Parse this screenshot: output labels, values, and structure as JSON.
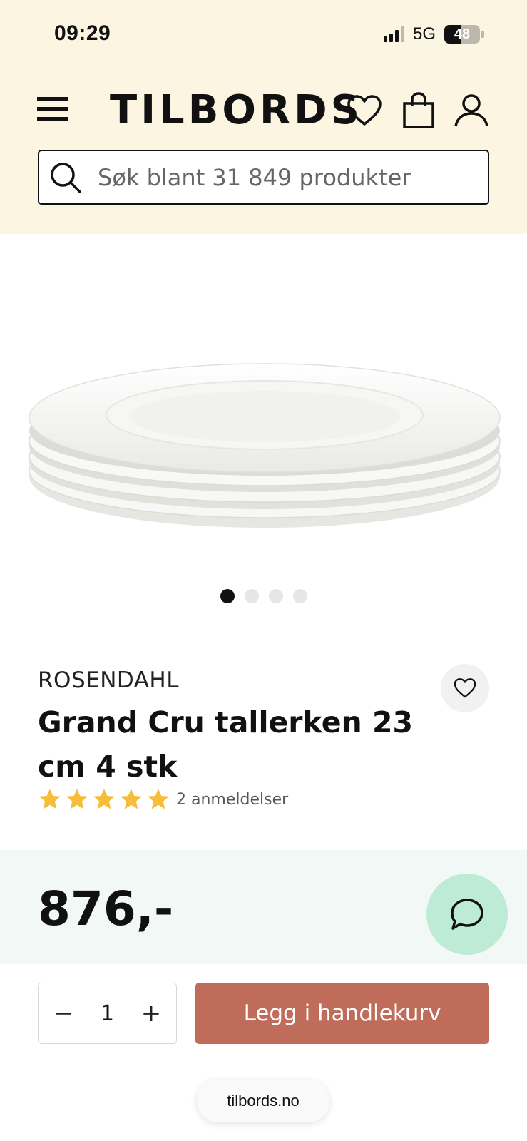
{
  "status_bar": {
    "time": "09:29",
    "network": "5G",
    "battery": "48",
    "battery_level": 0.48
  },
  "header": {
    "logo": "TILBORDS",
    "icons": [
      "menu-icon",
      "heart-icon",
      "bag-icon",
      "user-icon"
    ],
    "search_placeholder": "Søk blant 31 849 produkter"
  },
  "gallery": {
    "image": "stack of white plates",
    "dots_total": 4,
    "active_dot": 1
  },
  "product": {
    "brand": "ROSENDAHL",
    "title": "Grand Cru tallerken 23 cm 4 stk",
    "rating": 5,
    "reviews": "2 anmeldelser",
    "price": "876,-"
  },
  "purchase": {
    "minus": "−",
    "quantity": "1",
    "plus": "+",
    "add_to_cart": "Legg i handlekurv"
  },
  "browser": {
    "url": "tilbords.no"
  },
  "colors": {
    "header_bg": "#fcf5e2",
    "price_band_bg": "#f2f8f6",
    "chat_bg": "#bdebd6",
    "cart_button": "#c06c5a",
    "star": "#f6bd3b"
  }
}
